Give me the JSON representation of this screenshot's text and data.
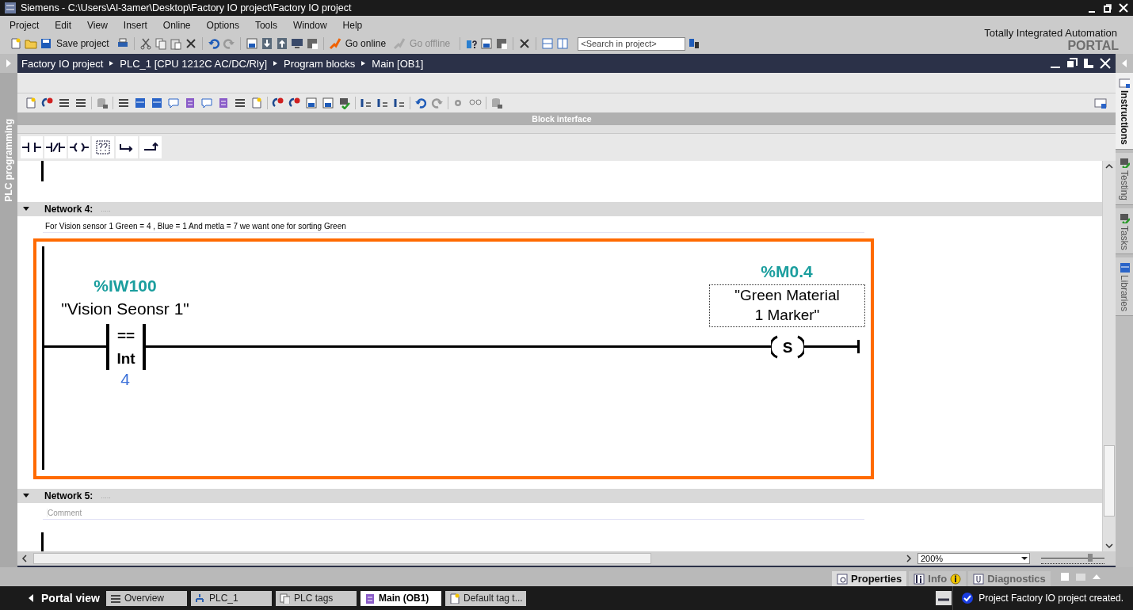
{
  "window": {
    "title": "Siemens  -  C:\\Users\\Al-3amer\\Desktop\\Factory IO project\\Factory IO project"
  },
  "menu": [
    "Project",
    "Edit",
    "View",
    "Insert",
    "Online",
    "Options",
    "Tools",
    "Window",
    "Help"
  ],
  "toolbar": {
    "save_label": "Save project",
    "go_online": {
      "label": "Go online",
      "disabled": false
    },
    "go_offline": {
      "label": "Go offline",
      "disabled": true
    },
    "search": {
      "placeholder": "<Search in project>"
    }
  },
  "branding": {
    "line1": "Totally Integrated Automation",
    "line2": "PORTAL"
  },
  "breadcrumb": [
    "Factory IO project",
    "PLC_1 [CPU 1212C AC/DC/Rly]",
    "Program blocks",
    "Main [OB1]"
  ],
  "left_tab": "PLC programming",
  "block_interface": "Block interface",
  "networks": [
    {
      "title": "Network 4:",
      "dots": ".....",
      "expanded": true,
      "comment": "For Vision sensor 1  Green = 4 , Blue = 1 And metla = 7 we want one for sorting Green",
      "highlighted": true,
      "contact": {
        "address": "%IW100",
        "tag": "\"Vision Seonsr 1\"",
        "operator": "==",
        "type": "Int",
        "operand": "4"
      },
      "coil": {
        "address": "%M0.4",
        "tag": "\"Green Material\n 1 Marker\"",
        "label": "S"
      }
    },
    {
      "title": "Network 5:",
      "dots": ".....",
      "expanded": true,
      "comment_placeholder": "Comment",
      "highlighted": false
    }
  ],
  "zoom": {
    "value": "200%",
    "level": 0.78
  },
  "right_tabs": [
    {
      "label": "Instructions",
      "selected": true
    },
    {
      "label": "Testing",
      "selected": false
    },
    {
      "label": "Tasks",
      "selected": false
    },
    {
      "label": "Libraries",
      "selected": false
    }
  ],
  "bottom_tabs": [
    {
      "label": "Properties",
      "selected": true
    },
    {
      "label": "Info",
      "selected": false
    },
    {
      "label": "Diagnostics",
      "selected": false
    }
  ],
  "portal_view": "Portal view",
  "taskbar": [
    {
      "label": "Overview",
      "selected": false
    },
    {
      "label": "PLC_1",
      "selected": false
    },
    {
      "label": "PLC tags",
      "selected": false
    },
    {
      "label": "Main (OB1)",
      "selected": true
    },
    {
      "label": "Default tag t...",
      "selected": false
    }
  ],
  "status_message": "Project Factory IO project created."
}
